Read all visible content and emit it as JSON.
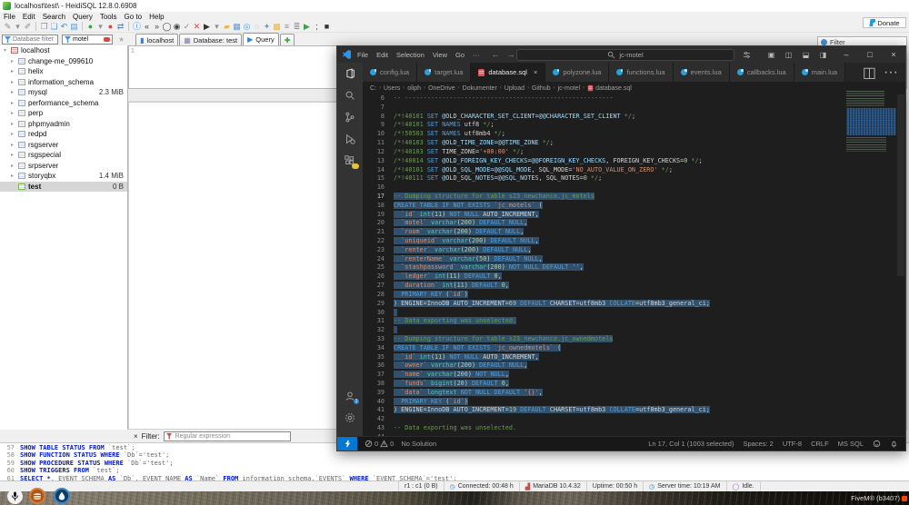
{
  "heidisql": {
    "title": "localhost\\test\\ - HeidiSQL 12.8.0.6908",
    "menus": [
      "File",
      "Edit",
      "Search",
      "Query",
      "Tools",
      "Go to",
      "Help"
    ],
    "toolbar_icons": [
      "session-edit",
      "dropdown",
      "session-new",
      "sep",
      "copy",
      "paste",
      "undo",
      "print",
      "sep",
      "connect",
      "dropdown",
      "disconnect",
      "refresh",
      "sep",
      "info",
      "first",
      "last",
      "stop",
      "record",
      "ok",
      "cancel",
      "run",
      "dropdown",
      "open",
      "save",
      "find",
      "replace",
      "format",
      "snippets",
      "insert",
      "layout",
      "run-green",
      "semicolon",
      "exit"
    ],
    "donate_label": "Donate",
    "database_filter_placeholder": "Database filter",
    "table_filter_value": "motel",
    "session_tabs": [
      {
        "label": "localhost",
        "icon": "server"
      },
      {
        "label": "Database: test",
        "icon": "database"
      },
      {
        "label": "Query",
        "icon": "query",
        "active": true
      },
      {
        "label": "",
        "icon": "add"
      }
    ],
    "tree": {
      "root": "localhost",
      "items": [
        {
          "name": "change-me_099610",
          "size": ""
        },
        {
          "name": "helix",
          "size": ""
        },
        {
          "name": "information_schema",
          "size": ""
        },
        {
          "name": "mysql",
          "size": "2.3 MiB"
        },
        {
          "name": "performance_schema",
          "size": ""
        },
        {
          "name": "perp",
          "size": ""
        },
        {
          "name": "phpmyadmin",
          "size": ""
        },
        {
          "name": "redpd",
          "size": ""
        },
        {
          "name": "rsgserver",
          "size": ""
        },
        {
          "name": "rsgspecial",
          "size": ""
        },
        {
          "name": "srpserver",
          "size": ""
        },
        {
          "name": "storyqbx",
          "size": "1.4 MiB"
        },
        {
          "name": "test",
          "size": "0 B",
          "selected": true
        }
      ]
    },
    "query_editor_line": "1",
    "filter_pill_label": "Filter",
    "filter_bar": {
      "close": "×",
      "label": "Filter:",
      "placeholder": "Regular expression"
    },
    "log": [
      {
        "num": "57",
        "sql": "SHOW TABLE STATUS FROM `test`;"
      },
      {
        "num": "58",
        "sql": "SHOW FUNCTION STATUS WHERE `Db`='test';"
      },
      {
        "num": "59",
        "sql": "SHOW PROCEDURE STATUS WHERE `Db`='test';"
      },
      {
        "num": "60",
        "sql": "SHOW TRIGGERS FROM `test`;"
      },
      {
        "num": "61",
        "sql": "SELECT *, EVENT_SCHEMA AS `Db`, EVENT_NAME AS `Name` FROM information_schema.`EVENTS` WHERE `EVENT_SCHEMA`='test';"
      }
    ],
    "status_bar": [
      {
        "icon": "",
        "text": "r1 : c1 (0 B)"
      },
      {
        "icon": "clock",
        "text": "Connected: 00:48 h"
      },
      {
        "icon": "chart",
        "text": "MariaDB 10.4.32"
      },
      {
        "icon": "",
        "text": "Uptime: 00:50 h"
      },
      {
        "icon": "clock",
        "text": "Server time: 10:19 AM"
      },
      {
        "icon": "idle",
        "text": "Idle."
      }
    ]
  },
  "vscode": {
    "menus": [
      "File",
      "Edit",
      "Selection",
      "View",
      "Go",
      "···"
    ],
    "search_value": "jc-motel",
    "tabs": [
      {
        "label": "config.lua",
        "icon": "lua"
      },
      {
        "label": "target.lua",
        "icon": "lua"
      },
      {
        "label": "database.sql",
        "icon": "dbsql",
        "active": true,
        "close": "×"
      },
      {
        "label": "polyzone.lua",
        "icon": "lua"
      },
      {
        "label": "functions.lua",
        "icon": "lua"
      },
      {
        "label": "events.lua",
        "icon": "lua"
      },
      {
        "label": "callbacks.lua",
        "icon": "lua"
      },
      {
        "label": "main.lua",
        "icon": "lua"
      }
    ],
    "breadcrumb": [
      "C:",
      "Users",
      "oliph",
      "OneDrive",
      "Dokumenter",
      "Upload",
      "Github",
      "jc-motel",
      "database.sql"
    ],
    "activity_bar": [
      "explorer",
      "search",
      "scm",
      "debug",
      "extensions"
    ],
    "activity_bottom": [
      "account",
      "settings"
    ],
    "code": {
      "first_line": 6,
      "selection_start": 17,
      "selection_end": 41,
      "lines": [
        "-- --------------------------------------------------------",
        "",
        "/*!40101 SET @OLD_CHARACTER_SET_CLIENT=@@CHARACTER_SET_CLIENT */;",
        "/*!40101 SET NAMES utf8 */;",
        "/*!50503 SET NAMES utf8mb4 */;",
        "/*!40103 SET @OLD_TIME_ZONE=@@TIME_ZONE */;",
        "/*!40103 SET TIME_ZONE='+00:00' */;",
        "/*!40014 SET @OLD_FOREIGN_KEY_CHECKS=@@FOREIGN_KEY_CHECKS, FOREIGN_KEY_CHECKS=0 */;",
        "/*!40101 SET @OLD_SQL_MODE=@@SQL_MODE, SQL_MODE='NO_AUTO_VALUE_ON_ZERO' */;",
        "/*!40111 SET @OLD_SQL_NOTES=@@SQL_NOTES, SQL_NOTES=0 */;",
        "",
        "-- Dumping structure for table s23_newchance.jc_motels",
        "CREATE TABLE IF NOT EXISTS `jc_motels` (",
        "  `id` int(11) NOT NULL AUTO_INCREMENT,",
        "  `motel` varchar(200) DEFAULT NULL,",
        "  `room` varchar(200) DEFAULT NULL,",
        "  `uniqueid` varchar(200) DEFAULT NULL,",
        "  `renter` varchar(200) DEFAULT NULL,",
        "  `renterName` varchar(50) DEFAULT NULL,",
        "  `stashpassword` varchar(200) NOT NULL DEFAULT '',",
        "  `ledger` int(11) DEFAULT 0,",
        "  `duration` int(11) DEFAULT 0,",
        "  PRIMARY KEY (`id`)",
        ") ENGINE=InnoDB AUTO_INCREMENT=69 DEFAULT CHARSET=utf8mb3 COLLATE=utf8mb3_general_ci;",
        "",
        "-- Data exporting was unselected.",
        "",
        "-- Dumping structure for table s23_newchance.jc_ownedmotels",
        "CREATE TABLE IF NOT EXISTS `jc_ownedmotels` (",
        "  `id` int(11) NOT NULL AUTO_INCREMENT,",
        "  `owner` varchar(200) DEFAULT NULL,",
        "  `name` varchar(200) NOT NULL,",
        "  `funds` bigint(20) DEFAULT 0,",
        "  `data` longtext NOT NULL DEFAULT '{}',",
        "  PRIMARY KEY (`id`)",
        ") ENGINE=InnoDB AUTO_INCREMENT=19 DEFAULT CHARSET=utf8mb3 COLLATE=utf8mb3_general_ci;",
        "",
        "-- Data exporting was unselected.",
        ""
      ]
    },
    "status": {
      "errors": "0",
      "warnings": "0",
      "solution": "No Solution",
      "right": [
        "Ln 17, Col 1 (1003 selected)",
        "Spaces: 2",
        "UTF-8",
        "CRLF",
        "MS SQL"
      ]
    }
  },
  "game": {
    "brand": "FiveM® (b3407)"
  }
}
